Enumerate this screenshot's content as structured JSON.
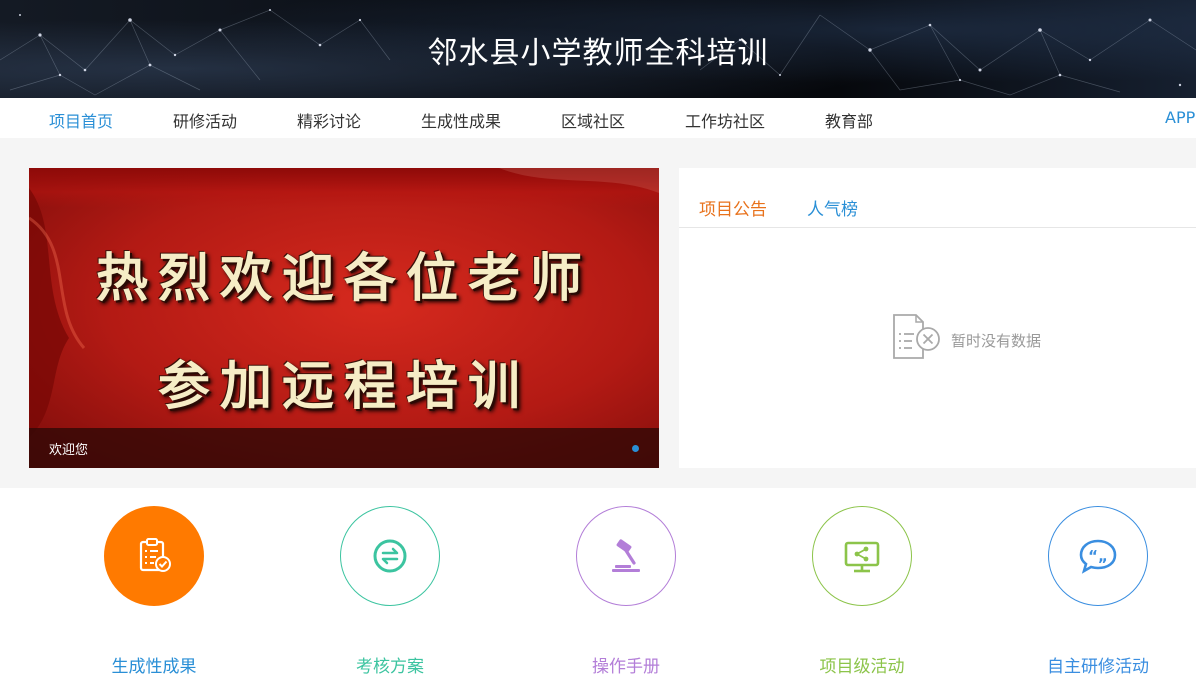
{
  "banner": {
    "title": "邻水县小学教师全科培训"
  },
  "nav": {
    "items": [
      {
        "label": "项目首页",
        "active": true
      },
      {
        "label": "研修活动"
      },
      {
        "label": "精彩讨论"
      },
      {
        "label": "生成性成果"
      },
      {
        "label": "区域社区"
      },
      {
        "label": "工作坊社区"
      },
      {
        "label": "教育部"
      }
    ],
    "app_label": "APP"
  },
  "carousel": {
    "slide_line1": "热烈欢迎各位老师",
    "slide_line2": "参加远程培训",
    "caption": "欢迎您"
  },
  "panel": {
    "tabs": [
      {
        "label": "项目公告",
        "active": true
      },
      {
        "label": "人气榜"
      }
    ],
    "empty_text": "暂时没有数据",
    "empty_icon": "no-data-document-icon"
  },
  "quick_links": [
    {
      "label": "生成性成果",
      "icon": "clipboard-check-icon",
      "color": "#ff7a00",
      "filled": true
    },
    {
      "label": "考核方案",
      "icon": "exchange-arrows-icon",
      "color": "#3cc4a0",
      "filled": false
    },
    {
      "label": "操作手册",
      "icon": "gavel-icon",
      "color": "#b37ed8",
      "filled": false
    },
    {
      "label": "项目级活动",
      "icon": "share-screen-icon",
      "color": "#8cc44a",
      "filled": false
    },
    {
      "label": "自主研修活动",
      "icon": "quote-bubble-icon",
      "color": "#3a8ee0",
      "filled": false
    }
  ],
  "colors": {
    "nav_active": "#2a8fd6",
    "panel_tab_active": "#e8721c",
    "panel_tab_inactive": "#2a8fd6"
  }
}
